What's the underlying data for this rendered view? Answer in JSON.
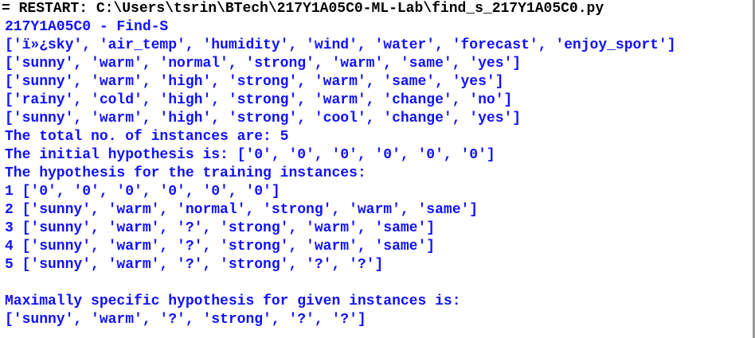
{
  "colors": {
    "restart_text": "#000000",
    "stdout_text": "#1010ff",
    "background": "#ffffff"
  },
  "shell": {
    "restart_line": "= RESTART: C:\\Users\\tsrin\\BTech\\217Y1A05C0-ML-Lab\\find_s_217Y1A05C0.py",
    "output_lines": [
      "217Y1A05C0 - Find-S",
      "['ï»¿sky', 'air_temp', 'humidity', 'wind', 'water', 'forecast', 'enjoy_sport']",
      "['sunny', 'warm', 'normal', 'strong', 'warm', 'same', 'yes']",
      "['sunny', 'warm', 'high', 'strong', 'warm', 'same', 'yes']",
      "['rainy', 'cold', 'high', 'strong', 'warm', 'change', 'no']",
      "['sunny', 'warm', 'high', 'strong', 'cool', 'change', 'yes']",
      "The total no. of instances are: 5",
      "The initial hypothesis is: ['0', '0', '0', '0', '0', '0']",
      "The hypothesis for the training instances:",
      "1 ['0', '0', '0', '0', '0', '0']",
      "2 ['sunny', 'warm', 'normal', 'strong', 'warm', 'same']",
      "3 ['sunny', 'warm', '?', 'strong', 'warm', 'same']",
      "4 ['sunny', 'warm', '?', 'strong', 'warm', 'same']",
      "5 ['sunny', 'warm', '?', 'strong', '?', '?']",
      "",
      "Maximally specific hypothesis for given instances is:",
      "['sunny', 'warm', '?', 'strong', '?', '?']"
    ]
  }
}
